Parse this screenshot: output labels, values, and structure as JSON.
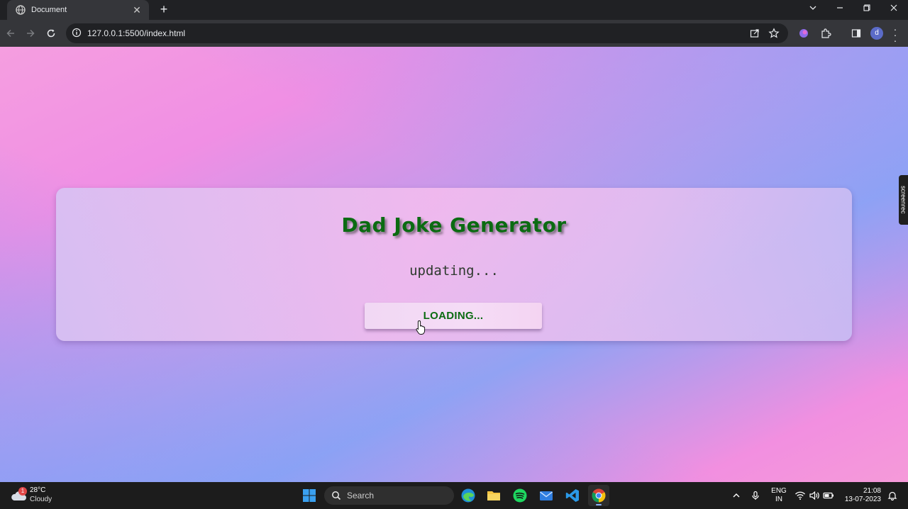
{
  "browser": {
    "tab_title": "Document",
    "url": "127.0.0.1:5500/index.html",
    "profile_initial": "d"
  },
  "page": {
    "title": "Dad Joke Generator",
    "joke_text": "updating...",
    "button_label": "LOADING..."
  },
  "side_badge": "screenrec",
  "taskbar": {
    "weather_temp": "28°C",
    "weather_condition": "Cloudy",
    "weather_badge": "1",
    "search_label": "Search",
    "lang_primary": "ENG",
    "lang_secondary": "IN",
    "time": "21:08",
    "date": "13-07-2023"
  },
  "colors": {
    "title_green": "#0b6b12",
    "chrome_dark": "#202124",
    "toolbar": "#35363a",
    "taskbar": "#1c1c1c"
  }
}
